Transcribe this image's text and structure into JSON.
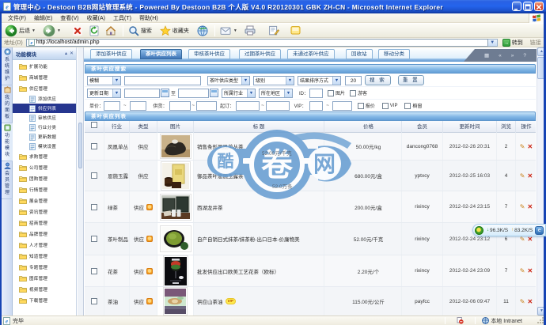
{
  "window": {
    "title": "管理中心 - Destoon B2B网站管理系统 - Powered By Destoon B2B 个人版 V4.0 R20120301 GBK ZH-CN - Microsoft Internet Explorer",
    "buttons": {
      "minimize": "_",
      "maximize": "□",
      "close": "✕"
    }
  },
  "menu_bar": {
    "items": [
      "文件(F)",
      "编辑(E)",
      "查看(V)",
      "收藏(A)",
      "工具(T)",
      "帮助(H)"
    ]
  },
  "toolbar": {
    "back_label": "后退",
    "search_label": "搜索",
    "favorites_label": "收藏夹"
  },
  "address_bar": {
    "label": "地址(D)",
    "url": "http://localhost/admin.php",
    "go_label": "转到",
    "links_label": "链接"
  },
  "sidebar": {
    "strip_tabs": [
      "系统维护",
      "我的面板",
      "功能模块",
      "会员管理"
    ],
    "panel_title": "功能模块",
    "tree": [
      {
        "label": "扩展功能"
      },
      {
        "label": "商城管理"
      },
      {
        "label": "供应管理"
      },
      {
        "label": "添加供应"
      },
      {
        "label": "供应列表"
      },
      {
        "label": "审核供应"
      },
      {
        "label": "行业分类"
      },
      {
        "label": "更新数据"
      },
      {
        "label": "模块设置"
      },
      {
        "label": "求购管理"
      },
      {
        "label": "公司管理"
      },
      {
        "label": "团购管理"
      },
      {
        "label": "行情管理"
      },
      {
        "label": "展会管理"
      },
      {
        "label": "资讯管理"
      },
      {
        "label": "招商管理"
      },
      {
        "label": "品牌管理"
      },
      {
        "label": "人才管理"
      },
      {
        "label": "知道管理"
      },
      {
        "label": "专题管理"
      },
      {
        "label": "图库管理"
      },
      {
        "label": "视频管理"
      },
      {
        "label": "下载管理"
      }
    ]
  },
  "tabs": {
    "items": [
      "添加茶叶供应",
      "茶叶供应列表",
      "审核茶叶供应",
      "过期茶叶供应",
      "未通过茶叶供应",
      "回收站",
      "移动分类"
    ],
    "active_index": 1
  },
  "search_panel": {
    "title": "茶叶供应搜索",
    "fuzzy_select": "模糊",
    "type_select": "茶叶供应类型",
    "level_select": "级别",
    "sort_select": "结果排序方式",
    "per_page": "20",
    "search_button": "搜 索",
    "reset_button": "重 置",
    "date_select": "更新日期",
    "date_to": "至",
    "industry_select": "所属行业",
    "region_select": "所在地区",
    "id_label": "ID：",
    "cb_image": "图片",
    "cb_guest": "游客",
    "price_label": "单价：",
    "supply_label": "供货：",
    "minorder_label": "起订：",
    "vip_label": "VIP：",
    "tilde": "~",
    "cb_quote": "报价",
    "cb_vip": "VIP",
    "cb_showcase": "橱窗"
  },
  "list_panel": {
    "title": "茶叶供应列表",
    "columns": [
      "行业",
      "类型",
      "图片",
      "标 题",
      "价格",
      "会员",
      "更新时间",
      "浏览",
      "操作"
    ],
    "rows": [
      {
        "industry": "凤凰单丛",
        "type": "供应",
        "title": "销售条形凤凰单丛茶",
        "price": "50.00元/kg",
        "member": "dancong0768",
        "updated": "2012-02-26 20:31",
        "views": "2"
      },
      {
        "industry": "恩施玉露",
        "type": "供应",
        "title": "御品茶叶恩施玉露茶",
        "price": "680.00元/盒",
        "member": "yptxcy",
        "updated": "2012-02-25 16:03",
        "views": "4"
      },
      {
        "industry": "绿茶",
        "type": "供应",
        "title": "西湖龙井茶",
        "price": "200.00元/盒",
        "member": "rixincy",
        "updated": "2012-02-24 23:15",
        "views": "7"
      },
      {
        "industry": "茶叶制品",
        "type": "供应",
        "title": "自产自销日式抹茶/抹茶粉-出口日本-价廉物美",
        "price": "52.00元/千克",
        "member": "rixincy",
        "updated": "2012-02-24 23:12",
        "views": "6"
      },
      {
        "industry": "花茶",
        "type": "供应",
        "title": "批发供应出口欧美工艺花茶（欧标）",
        "price": "2.20元/个",
        "member": "rixincy",
        "updated": "2012-02-24 23:09",
        "views": "7"
      },
      {
        "industry": "茶油",
        "type": "供应",
        "title": "供应山茶油",
        "vip_badge": "VIP",
        "price": "115.00元/公斤",
        "member": "payfcc",
        "updated": "2012-02-06 09:47",
        "views": "11"
      }
    ]
  },
  "frame_controls": {
    "icons": [
      "▦",
      "«",
      "»",
      "?"
    ]
  },
  "status_bar": {
    "done": "完毕",
    "zone": "本地 Intranet"
  },
  "watermark": {
    "left_char": "酷",
    "center_char": "卷",
    "right_char": "网",
    "ghost_top": "52.00元/千克",
    "ghost_bottom": "52.0万条"
  },
  "speed_widget": {
    "down": "96.3K/S",
    "up": "83.2K/S"
  },
  "colors": {
    "titlebar": "#2464ec",
    "tree_selected": "#26368f",
    "section_bar": "#6fa8da",
    "tab_active": "#4a82c0",
    "vip_orange": "#f5a623",
    "watermark_blue": "#6096cc"
  }
}
